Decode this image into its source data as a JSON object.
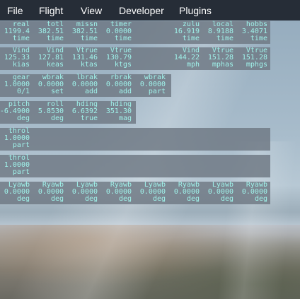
{
  "menu": [
    "File",
    "Flight",
    "View",
    "Developer",
    "Plugins"
  ],
  "rows": [
    [
      {
        "name": "real",
        "value": "1199.4",
        "unit": "time"
      },
      {
        "name": "totl",
        "value": "382.51",
        "unit": "time"
      },
      {
        "name": "missn",
        "value": "382.51",
        "unit": "time"
      },
      {
        "name": "timer",
        "value": "0.0000",
        "unit": "time"
      },
      null,
      {
        "name": "zulu",
        "value": "16.919",
        "unit": "time"
      },
      {
        "name": "local",
        "value": "8.9188",
        "unit": "time"
      },
      {
        "name": "hobbs",
        "value": "3.4071",
        "unit": "time"
      }
    ],
    [
      {
        "name": "Vind",
        "value": "125.33",
        "unit": "kias"
      },
      {
        "name": "Vind",
        "value": "127.81",
        "unit": "keas"
      },
      {
        "name": "Vtrue",
        "value": "131.46",
        "unit": "ktas"
      },
      {
        "name": "Vtrue",
        "value": "130.79",
        "unit": "ktgs"
      },
      null,
      {
        "name": "Vind",
        "value": "144.22",
        "unit": "mph"
      },
      {
        "name": "Vtrue",
        "value": "151.28",
        "unit": "mphas"
      },
      {
        "name": "Vtrue",
        "value": "151.28",
        "unit": "mphgs"
      }
    ],
    [
      {
        "name": "gear",
        "value": "1.0000",
        "unit": "0/1"
      },
      {
        "name": "wbrak",
        "value": "0.0000",
        "unit": "set"
      },
      {
        "name": "lbrak",
        "value": "0.0000",
        "unit": "add"
      },
      {
        "name": "rbrak",
        "value": "0.0000",
        "unit": "add"
      },
      {
        "name": "wbrak",
        "value": "0.0000",
        "unit": "part"
      }
    ],
    [
      {
        "name": "pitch",
        "value": "-6.4900",
        "unit": "deg"
      },
      {
        "name": "roll",
        "value": "5.8530",
        "unit": "deg"
      },
      {
        "name": "hding",
        "value": "6.6392",
        "unit": "true"
      },
      {
        "name": "hding",
        "value": "351.30",
        "unit": "mag"
      }
    ],
    [
      {
        "name": "throl",
        "value": "1.0000",
        "unit": "part"
      }
    ],
    [
      {
        "name": "throl",
        "value": "1.0000",
        "unit": "part"
      }
    ],
    [
      {
        "name": "Lyawb",
        "value": "0.0000",
        "unit": "deg"
      },
      {
        "name": "Ryawb",
        "value": "0.0000",
        "unit": "deg"
      },
      {
        "name": "Lyawb",
        "value": "0.0000",
        "unit": "deg"
      },
      {
        "name": "Ryawb",
        "value": "0.0000",
        "unit": "deg"
      },
      {
        "name": "Lyawb",
        "value": "0.0000",
        "unit": "deg"
      },
      {
        "name": "Ryawb",
        "value": "0.0000",
        "unit": "deg"
      },
      {
        "name": "Lyawb",
        "value": "0.0000",
        "unit": "deg"
      },
      {
        "name": "Ryawb",
        "value": "0.0000",
        "unit": "deg"
      }
    ]
  ]
}
